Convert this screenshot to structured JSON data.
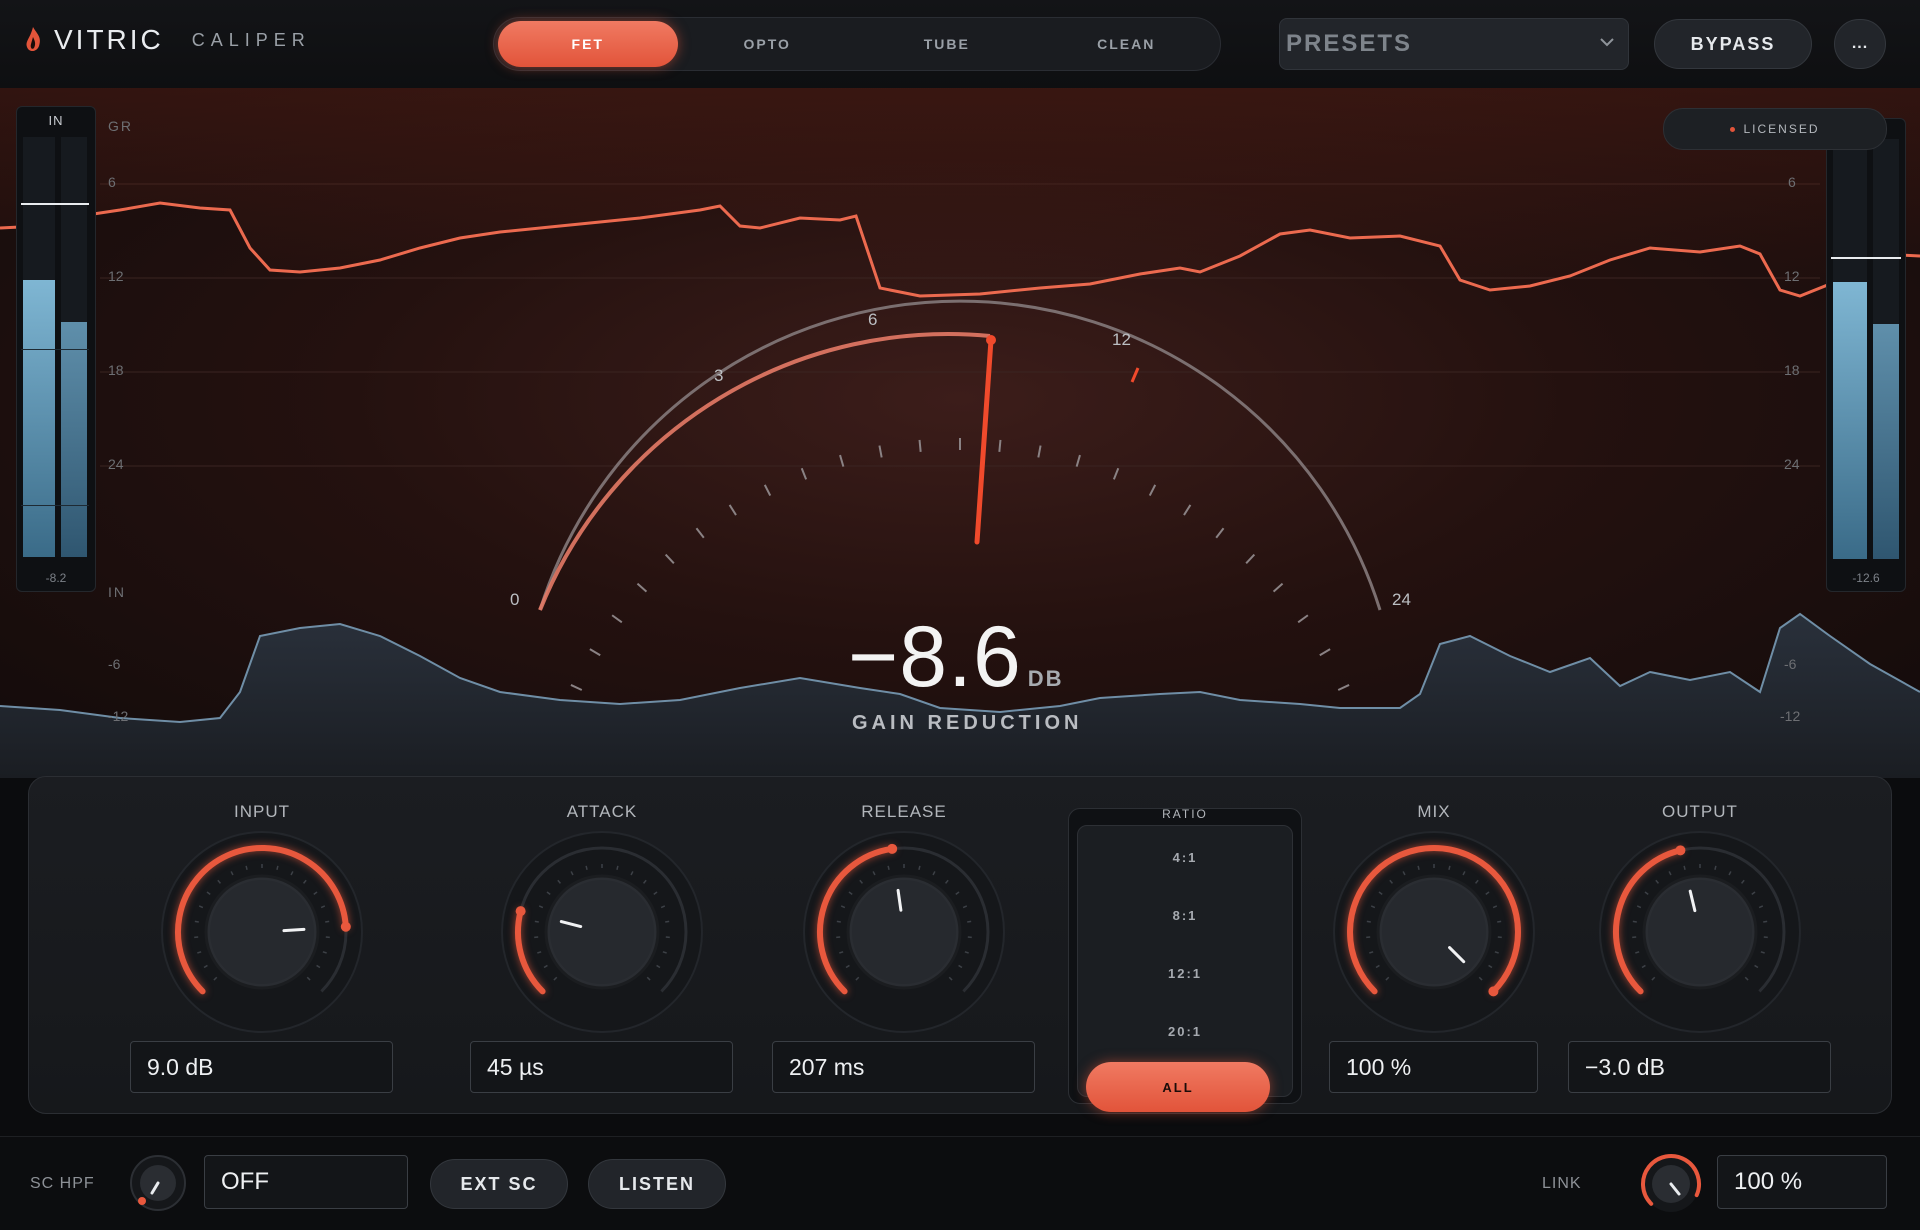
{
  "app": {
    "brand": "VITRIC",
    "product": "CALIPER"
  },
  "modes": {
    "items": [
      "FET",
      "OPTO",
      "TUBE",
      "CLEAN"
    ],
    "active": "FET"
  },
  "presets": {
    "label": "PRESETS"
  },
  "header_buttons": {
    "bypass": "BYPASS",
    "more": "..."
  },
  "license": {
    "label": "LICENSED"
  },
  "meters": {
    "input": {
      "label": "IN",
      "peak": "-8.2",
      "level_left": 0.66,
      "level_right": 0.56
    },
    "output": {
      "label": "",
      "peak": "-12.6",
      "level_left": 0.66,
      "level_right": 0.56
    }
  },
  "graph": {
    "gr_label": "GR",
    "gr_ticks": [
      "6",
      "12",
      "18",
      "24"
    ],
    "in_label": "IN",
    "in_ticks": [
      "-6",
      "-12"
    ],
    "right_gr_ticks": [
      "6",
      "12",
      "18",
      "24"
    ],
    "right_in_ticks": [
      "-6",
      "-12"
    ]
  },
  "dial": {
    "ticks": [
      "0",
      "3",
      "6",
      "12",
      "24"
    ],
    "needle_db": 8.6
  },
  "gain_reduction": {
    "value": "−8.6",
    "unit": "DB",
    "label": "GAIN REDUCTION"
  },
  "controls": {
    "input": {
      "label": "INPUT",
      "value": "9.0 dB",
      "pos": 0.82
    },
    "attack": {
      "label": "ATTACK",
      "value": "45 µs",
      "pos": 0.22
    },
    "release": {
      "label": "RELEASE",
      "value": "207 ms",
      "pos": 0.47
    },
    "mix": {
      "label": "MIX",
      "value": "100 %",
      "pos": 1.0
    },
    "output": {
      "label": "OUTPUT",
      "value": "−3.0 dB",
      "pos": 0.45
    }
  },
  "ratio": {
    "title": "RATIO",
    "options": [
      "4:1",
      "8:1",
      "12:1",
      "20:1"
    ],
    "selected": "ALL"
  },
  "bottom": {
    "sc_hpf_label": "SC HPF",
    "sc_hpf_value": "OFF",
    "ext_sc": "EXT SC",
    "listen": "LISTEN",
    "link_label": "LINK",
    "link_value": "100 %",
    "link_pos": 0.92
  },
  "colors": {
    "accent": "#e8583d",
    "meter_blue": "#6fa6c4",
    "bg": "#0b0c0e"
  }
}
